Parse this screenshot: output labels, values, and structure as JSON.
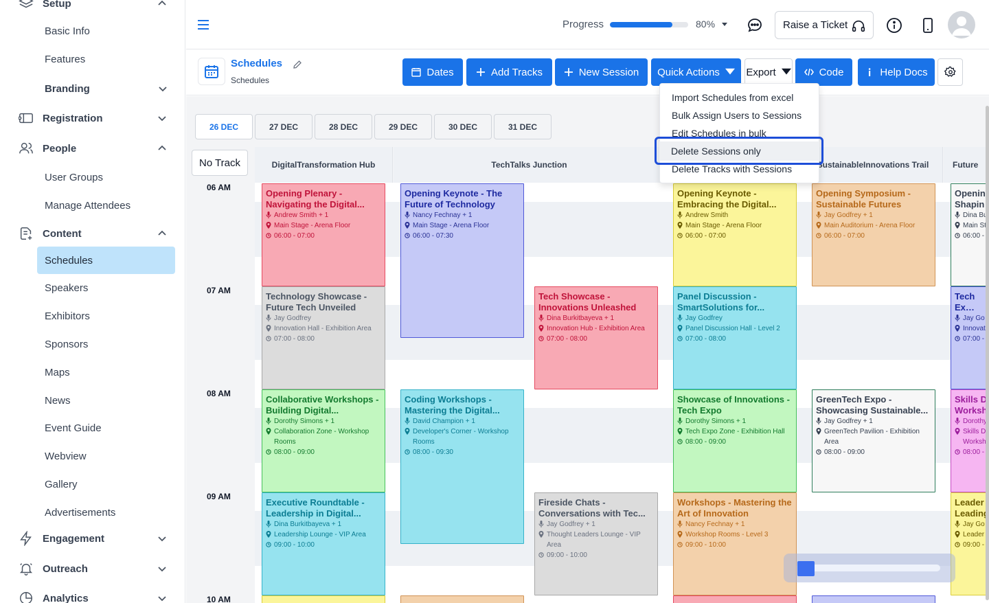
{
  "sidebar": {
    "setup": "Setup",
    "basic_info": "Basic Info",
    "features": "Features",
    "branding": "Branding",
    "registration": "Registration",
    "people": "People",
    "user_groups": "User Groups",
    "manage_attendees": "Manage Attendees",
    "content": "Content",
    "schedules": "Schedules",
    "speakers": "Speakers",
    "exhibitors": "Exhibitors",
    "sponsors": "Sponsors",
    "maps": "Maps",
    "news": "News",
    "event_guide": "Event Guide",
    "webview": "Webview",
    "gallery": "Gallery",
    "advertisements": "Advertisements",
    "engagement": "Engagement",
    "outreach": "Outreach",
    "analytics": "Analytics"
  },
  "topbar": {
    "progress_label": "Progress",
    "progress_value": 0.8,
    "progress_text": "80%",
    "ticket_label": "Raise a Ticket"
  },
  "header": {
    "title": "Schedules",
    "subtitle": "Schedules",
    "buttons": {
      "dates": "Dates",
      "add_tracks": "Add Tracks",
      "new_session": "New Session",
      "quick_actions": "Quick Actions",
      "export": "Export",
      "code": "Code",
      "help_docs": "Help Docs"
    }
  },
  "quick_actions_menu": [
    "Import Schedules from excel",
    "Bulk Assign Users to Sessions",
    "Edit Schedules in bulk",
    "Delete Sessions only",
    "Delete Tracks with Sessions"
  ],
  "dates": [
    "26 DEC",
    "27 DEC",
    "28 DEC",
    "29 DEC",
    "30 DEC",
    "31 DEC"
  ],
  "no_track": "No Track",
  "tracks": [
    "DigitalTransformation Hub",
    "TechTalks Junction",
    "SustainableInnovations Trail",
    "Future"
  ],
  "times": [
    "06 AM",
    "07 AM",
    "08 AM",
    "09 AM",
    "10 AM"
  ],
  "sessions": [
    {
      "title": "Opening Plenary - Navigating the Digital...",
      "speaker": "Andrew Smith + 1",
      "location": "Main Stage - Arena Floor",
      "time": "06:00 - 07:00"
    },
    {
      "title": "Technology Showcase - Future Tech Unveiled",
      "speaker": "Jay Godfrey",
      "location": "Innovation Hall - Exhibition Area",
      "time": "07:00 - 08:00"
    },
    {
      "title": "Collaborative Workshops - Building Digital...",
      "speaker": "Dorothy Simons + 1",
      "location": "Collaboration Zone - Workshop Rooms",
      "time": "08:00 - 09:00"
    },
    {
      "title": "Executive Roundtable - Leadership in Digital...",
      "speaker": "Dina Burkitbayeva + 1",
      "location": "Leadership Lounge - VIP Area",
      "time": "09:00 - 10:00"
    },
    {
      "title": "Opening Keynote - The Future of Technology",
      "speaker": "Nancy Fechnay + 1",
      "location": "Main Stage - Arena Floor",
      "time": "06:00 - 07:30"
    },
    {
      "title": "Coding Workshops - Mastering the Digital...",
      "speaker": "David Champion + 1",
      "location": "Developer's Corner - Workshop Rooms",
      "time": "08:00 - 09:30"
    },
    {
      "title": "Tech Showcase - Innovations Unleashed",
      "speaker": "Dina Burkitbayeva + 1",
      "location": "Innovation Hub - Exhibition Area",
      "time": "07:00 - 08:00"
    },
    {
      "title": "Fireside Chats - Conversations with Tec...",
      "speaker": "Jay Godfrey + 1",
      "location": "Thought Leaders Lounge - VIP Area",
      "time": "09:00 - 10:00"
    },
    {
      "title": "Opening Keynote - Embracing the Digital...",
      "speaker": "Andrew Smith",
      "location": "Main Stage - Arena Floor",
      "time": "06:00 - 07:00"
    },
    {
      "title": "Panel Discussion - SmartSolutions for...",
      "speaker": "Jay Godfrey",
      "location": "Panel Discussion Hall - Level 2",
      "time": "07:00 - 08:00"
    },
    {
      "title": "Showcase of Innovations - Tech Expo",
      "speaker": "Dorothy Simons + 1",
      "location": "Tech Expo Zone - Exhibition Hall",
      "time": "08:00 - 09:00"
    },
    {
      "title": "Workshops - Mastering the Art of Innovation",
      "speaker": "Nancy Fechnay + 1",
      "location": "Workshop Rooms - Level 3",
      "time": "09:00 - 10:00"
    },
    {
      "title": "Opening Symposium - Sustainable Futures",
      "speaker": "Jay Godfrey + 1",
      "location": "Main Auditorium - Arena Floor",
      "time": "06:00 - 07:00"
    },
    {
      "title": "GreenTech Expo - Showcasing Sustainable...",
      "speaker": "Jay Godfrey + 1",
      "location": "GreenTech Pavilion - Exhibition Area",
      "time": "08:00 - 09:00"
    },
    {
      "title": "Openin Shapin",
      "speaker": "Dina Bu",
      "location": "Main St",
      "time": "06:00 -"
    },
    {
      "title": "Tech Ex Workfo",
      "speaker": "Jay Go",
      "location": "Innovat",
      "time": "07:00 -"
    },
    {
      "title": "Skills D Worksh",
      "speaker": "Dorothy",
      "location": "Skills D Worksho",
      "time": "08:00 -"
    },
    {
      "title": "Leader Leading",
      "speaker": "Jay Go",
      "location": "Leader",
      "time": "09:00 -"
    }
  ],
  "colors": {
    "accent": "#1a73e8",
    "active_nav": "#bfe3fb",
    "highlight_border": "#1d4ed8"
  }
}
